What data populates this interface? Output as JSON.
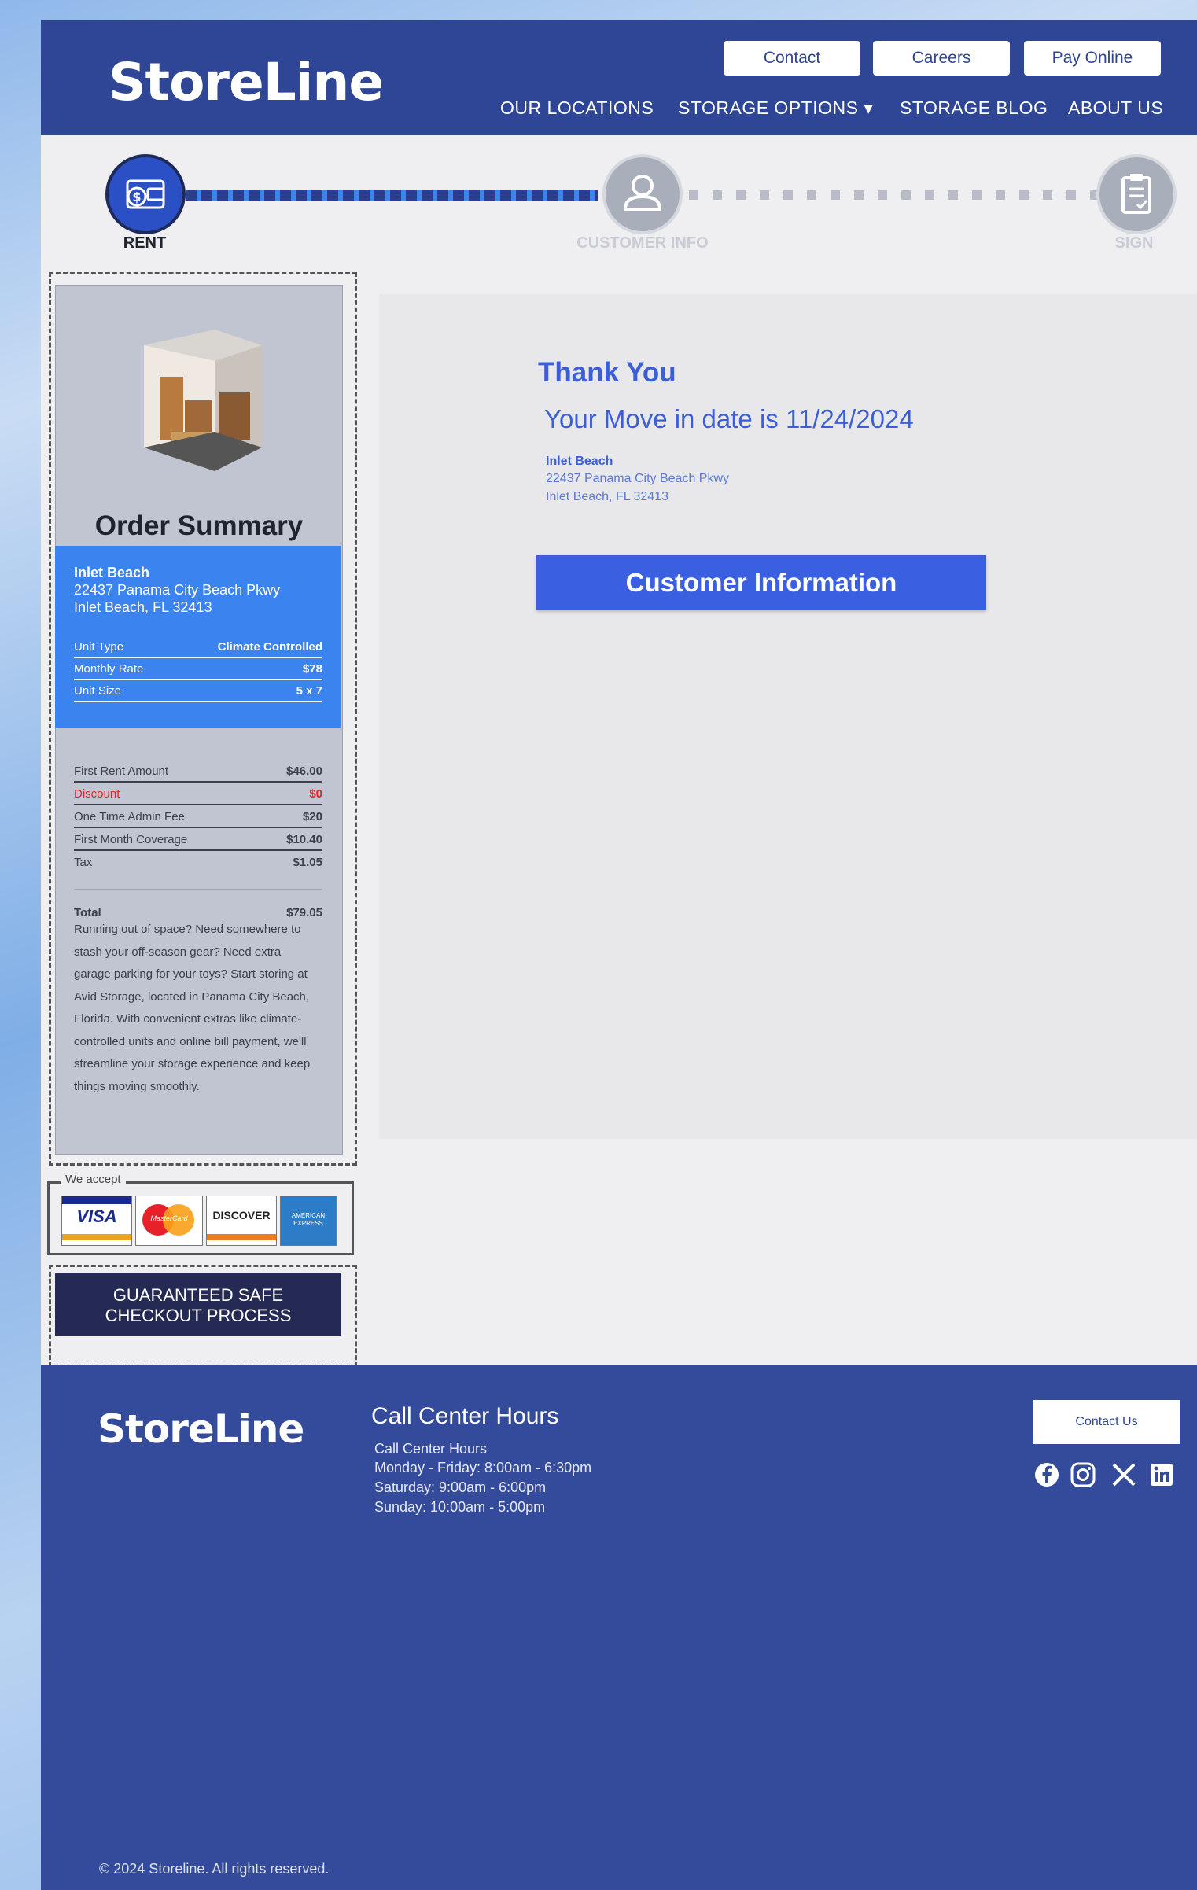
{
  "header": {
    "logo": "StoreLine",
    "buttons": [
      "Contact",
      "Careers",
      "Pay Online"
    ],
    "nav": [
      "OUR LOCATIONS",
      "STORAGE OPTIONS ▾",
      "STORAGE BLOG",
      "ABOUT US"
    ]
  },
  "steps": [
    {
      "label": "RENT",
      "icon": "wallet-icon",
      "state": "active"
    },
    {
      "label": "CUSTOMER INFO",
      "icon": "user-icon",
      "state": "inactive"
    },
    {
      "label": "SIGN",
      "icon": "clipboard-icon",
      "state": "inactive"
    }
  ],
  "summary": {
    "title": "Order Summary",
    "location_name": "Inlet Beach",
    "address1": "22437 Panama City Beach Pkwy",
    "address2": "Inlet Beach, FL 32413",
    "unit": [
      {
        "label": "Unit Type",
        "value": "Climate Controlled"
      },
      {
        "label": "Monthly Rate",
        "value": "$78"
      },
      {
        "label": "Unit Size",
        "value": "5 x 7"
      }
    ],
    "fees": [
      {
        "label": "First Rent Amount",
        "value": "$46.00"
      },
      {
        "label": "Discount",
        "value": "$0"
      },
      {
        "label": "One Time Admin Fee",
        "value": "$20"
      },
      {
        "label": "First Month Coverage",
        "value": "$10.40"
      },
      {
        "label": "Tax",
        "value": "$1.05"
      }
    ],
    "total_label": "Total",
    "total_value": "$79.05",
    "description": "Running out of space? Need somewhere to stash your off-season gear? Need extra garage parking for your toys? Start storing at Avid Storage, located in Panama City Beach, Florida. With convenient extras like climate-controlled units and online bill payment, we'll streamline your storage experience and keep things moving smoothly."
  },
  "payment": {
    "label": "We accept",
    "cards": [
      "VISA",
      "MasterCard",
      "DISCOVER",
      "AMERICAN EXPRESS"
    ]
  },
  "safe_checkout": {
    "line1": "GUARANTEED SAFE",
    "line2": "CHECKOUT PROCESS"
  },
  "main": {
    "thank_you": "Thank You",
    "move_in": "Your Move in date is 11/24/2024",
    "location_name": "Inlet Beach",
    "address1": "22437 Panama City Beach Pkwy",
    "address2": "Inlet Beach, FL 32413",
    "button": "Customer Information"
  },
  "footer": {
    "logo": "StoreLine",
    "hours_title": "Call Center Hours",
    "hours": [
      "Call Center Hours",
      "Monday - Friday: 8:00am - 6:30pm",
      "Saturday: 9:00am - 6:00pm",
      "Sunday: 10:00am - 5:00pm"
    ],
    "contact_button": "Contact Us",
    "social": [
      "facebook-icon",
      "instagram-icon",
      "x-icon",
      "linkedin-icon"
    ],
    "copyright": "© 2024 Storeline. All rights reserved."
  },
  "colors": {
    "brand": "#2f4595",
    "accent": "#3a84f0",
    "button": "#3a5fe0"
  }
}
